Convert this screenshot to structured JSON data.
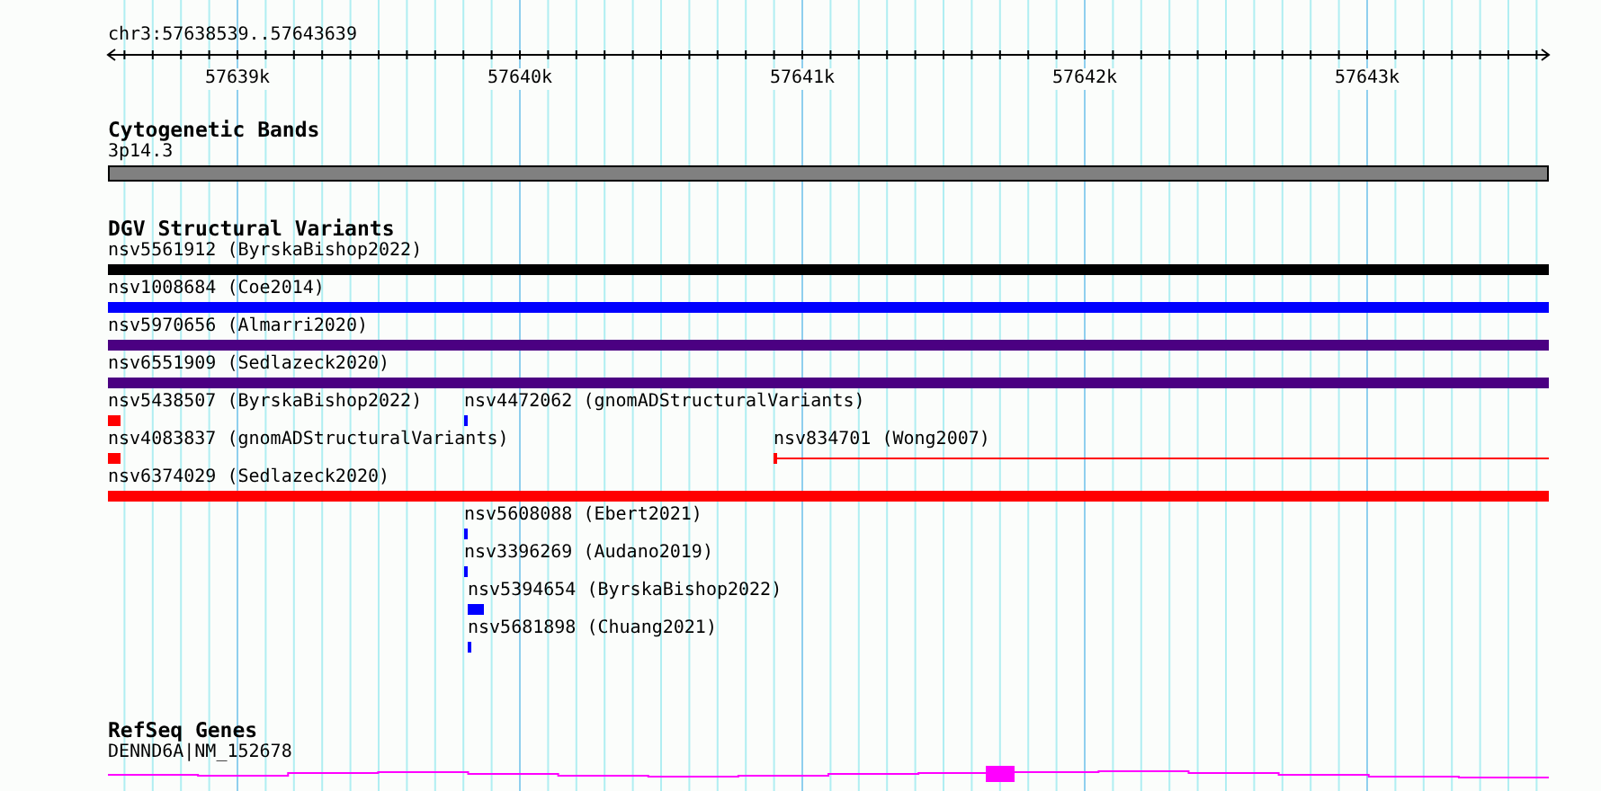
{
  "ruler": {
    "label": "chr3:57638539..57643639",
    "ticks": [
      {
        "label": "57639k"
      },
      {
        "label": "57640k"
      },
      {
        "label": "57641k"
      },
      {
        "label": "57642k"
      },
      {
        "label": "57643k"
      }
    ]
  },
  "tracks": [
    {
      "title": "Cytogenetic Bands",
      "kind": "bands",
      "rows": [
        {
          "features": [
            {
              "label": "3p14.3",
              "color": "#808080",
              "kind": "band"
            }
          ]
        }
      ]
    },
    {
      "title": "DGV Structural Variants",
      "kind": "variants",
      "rows": [
        {
          "features": [
            {
              "label": "nsv5561912 (ByrskaBishop2022)",
              "color": "#000000",
              "kind": "box"
            }
          ]
        },
        {
          "features": [
            {
              "label": "nsv1008684 (Coe2014)",
              "color": "#0000ff",
              "kind": "box"
            }
          ]
        },
        {
          "features": [
            {
              "label": "nsv5970656 (Almarri2020)",
              "color": "#4b0082",
              "kind": "box"
            }
          ]
        },
        {
          "features": [
            {
              "label": "nsv6551909 (Sedlazeck2020)",
              "color": "#4b0082",
              "kind": "box"
            }
          ]
        },
        {
          "features": [
            {
              "label": "nsv5438507 (ByrskaBishop2022)",
              "color": "#ff0000",
              "kind": "box"
            },
            {
              "label": "nsv4472062 (gnomADStructuralVariants)",
              "color": "#0000ff",
              "kind": "box"
            }
          ]
        },
        {
          "features": [
            {
              "label": "nsv4083837 (gnomADStructuralVariants)",
              "color": "#ff0000",
              "kind": "box"
            },
            {
              "label": "nsv834701 (Wong2007)",
              "color": "#ff0000",
              "kind": "line"
            }
          ]
        },
        {
          "features": [
            {
              "label": "nsv6374029 (Sedlazeck2020)",
              "color": "#ff0000",
              "kind": "box"
            }
          ]
        },
        {
          "features": [
            {
              "label": "nsv5608088 (Ebert2021)",
              "color": "#0000ff",
              "kind": "box"
            }
          ]
        },
        {
          "features": [
            {
              "label": "nsv3396269 (Audano2019)",
              "color": "#0000ff",
              "kind": "box"
            }
          ]
        },
        {
          "features": [
            {
              "label": "nsv5394654 (ByrskaBishop2022)",
              "color": "#0000ff",
              "kind": "box"
            }
          ]
        },
        {
          "features": [
            {
              "label": "nsv5681898 (Chuang2021)",
              "color": "#0000ff",
              "kind": "box"
            }
          ]
        }
      ]
    },
    {
      "title": "RefSeq Genes",
      "kind": "genes",
      "rows": [
        {
          "features": [
            {
              "label": "DENND6A|NM_152678",
              "color": "#ff00ff",
              "kind": "gene"
            }
          ]
        }
      ]
    }
  ]
}
